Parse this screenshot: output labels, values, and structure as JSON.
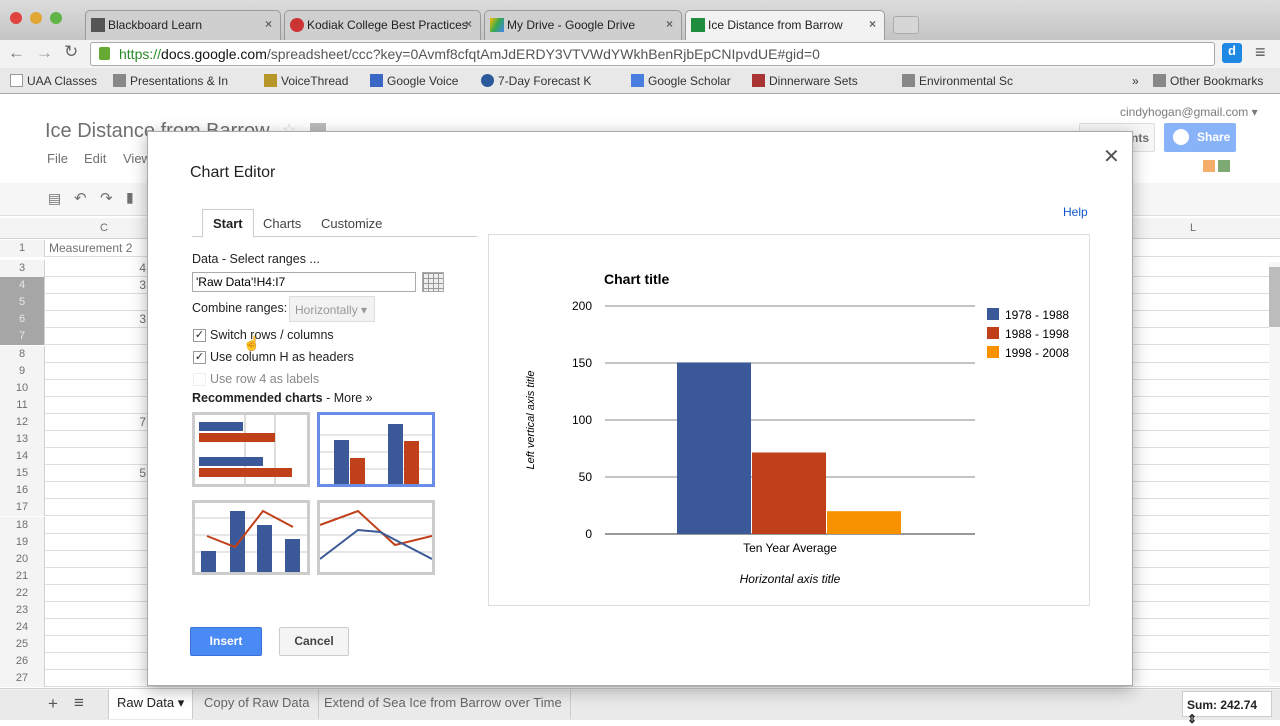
{
  "browser": {
    "tabs": [
      {
        "label": "Blackboard Learn"
      },
      {
        "label": "Kodiak College Best Practices"
      },
      {
        "label": "My Drive - Google Drive"
      },
      {
        "label": "Ice Distance from Barrow"
      }
    ],
    "url_scheme": "https://",
    "url_host": "docs.google.com",
    "url_path": "/spreadsheet/ccc?key=0Avmf8cfqtAmJdERDY3VTVWdYWkhBenRjbEpCNIpvdUE#gid=0",
    "bookmarks": [
      "UAA Classes",
      "Presentations & In",
      "VoiceThread",
      "Google Voice",
      "7-Day Forecast K",
      "Google Scholar",
      "Dinnerware Sets",
      "Environmental Sc"
    ],
    "bookmarks_overflow": "»",
    "other_bookmarks": "Other Bookmarks"
  },
  "app": {
    "title": "Ice Distance from Barrow",
    "menus": [
      "File",
      "Edit",
      "View"
    ],
    "user": "cindyhogan@gmail.com",
    "comments_label": "Comments",
    "share_label": "Share",
    "col_headers": {
      "c": "C",
      "l": "L"
    },
    "cells": {
      "c1": "Measurement 2",
      "c3": "4",
      "c4": "3",
      "c6": "3",
      "c12": "7",
      "c15": "5"
    },
    "rows": [
      "1",
      "3",
      "4",
      "5",
      "6",
      "7",
      "8",
      "9",
      "10",
      "11",
      "12",
      "13",
      "14",
      "15",
      "16",
      "17",
      "18",
      "19",
      "20",
      "21",
      "22",
      "23",
      "24",
      "25",
      "26",
      "27"
    ],
    "sheets": [
      "Raw Data",
      "Copy of Raw Data",
      "Extend of Sea Ice from Barrow over Time"
    ],
    "sum": "Sum: 242.74"
  },
  "editor": {
    "title": "Chart Editor",
    "help": "Help",
    "tabs": [
      "Start",
      "Charts",
      "Customize"
    ],
    "data_label": "Data",
    "data_hint": " - Select ranges ...",
    "range_value": "'Raw Data'!H4:I7",
    "combine_label": "Combine ranges:",
    "combine_value": "Horizontally",
    "checkboxes": [
      {
        "label": "Switch rows / columns",
        "checked": true
      },
      {
        "label": "Use column H as headers",
        "checked": true
      },
      {
        "label": "Use row 4 as labels",
        "checked": false
      }
    ],
    "recommended": "Recommended charts",
    "more": " - More »",
    "insert": "Insert",
    "cancel": "Cancel"
  },
  "chart_data": {
    "type": "bar",
    "title": "Chart title",
    "xlabel": "Horizontal axis title",
    "ylabel": "Left vertical axis title",
    "categories": [
      "Ten Year Average"
    ],
    "series": [
      {
        "name": "1978 - 1988",
        "values": [
          150.5
        ],
        "color": "#3b5998"
      },
      {
        "name": "1988 - 1998",
        "values": [
          71.5
        ],
        "color": "#c0401a"
      },
      {
        "name": "1998 - 2008",
        "values": [
          20
        ],
        "color": "#f79100"
      }
    ],
    "ylim": [
      0,
      200
    ],
    "yticks": [
      "0",
      "50",
      "100",
      "150",
      "200"
    ],
    "grid": true,
    "legend": "right"
  }
}
